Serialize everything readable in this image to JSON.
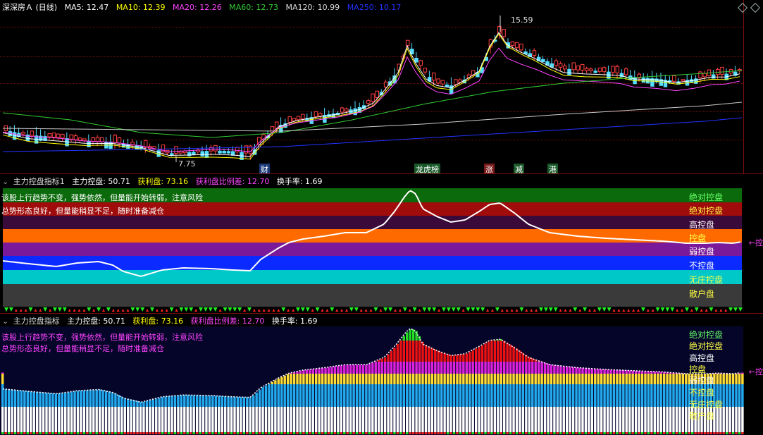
{
  "main": {
    "title": "深深房Ａ (日线)",
    "ma": [
      {
        "label": "MA5: 12.47",
        "color": "#ffffff"
      },
      {
        "label": "MA10: 12.39",
        "color": "#ffff00"
      },
      {
        "label": "MA20: 12.26",
        "color": "#ff44ff"
      },
      {
        "label": "MA60: 12.73",
        "color": "#33cc33"
      },
      {
        "label": "MA120: 10.99",
        "color": "#dddddd"
      },
      {
        "label": "MA250: 10.17",
        "color": "#2233ff"
      }
    ],
    "high_label": "15.59",
    "low_label": "7.75",
    "events": [
      {
        "text": "财",
        "bg": "#1a3a7a",
        "fg": "#ffffff"
      },
      {
        "text": "龙虎榜",
        "bg": "#1a5a2a",
        "fg": "#ffffff"
      },
      {
        "text": "涨",
        "bg": "#7a1a1a",
        "fg": "#ffffff"
      },
      {
        "text": "减",
        "bg": "#1a5a2a",
        "fg": "#ffffff"
      },
      {
        "text": "港",
        "bg": "#1a5a2a",
        "fg": "#ffffff"
      }
    ]
  },
  "panel1": {
    "title": "主力控盘指标1",
    "stats": [
      {
        "text": "主力控盘: 50.71",
        "color": "#ffffff"
      },
      {
        "text": "获利盘: 73.16",
        "color": "#ffff00"
      },
      {
        "text": "获利盘比例差: 12.70",
        "color": "#ff44ff"
      },
      {
        "text": "换手率: 1.69",
        "color": "#ffffff"
      }
    ],
    "note1": "该股上行趋势不变，强势依然，但量能开始转弱，注意风险",
    "note2": "总势形态良好，但量能稍显不足，随时准备减仓",
    "right_label": "←控",
    "bands": [
      {
        "label": "绝对控盘",
        "bg": "#0b6a0b",
        "fg": "#66ff66"
      },
      {
        "label": "绝对控盘",
        "bg": "#a00b0b",
        "fg": "#ffff44"
      },
      {
        "label": "高控盘",
        "bg": "#3a0a3a",
        "fg": "#ffffff"
      },
      {
        "label": "控盘",
        "bg": "#ff6a00",
        "fg": "#ffff44"
      },
      {
        "label": "弱控盘",
        "bg": "#7a1a9a",
        "fg": "#ffffff"
      },
      {
        "label": "不控盘",
        "bg": "#0a2aff",
        "fg": "#ffffff"
      },
      {
        "label": "无庄控盘",
        "bg": "#00c8c8",
        "fg": "#ffff44"
      },
      {
        "label": "散户盘",
        "bg": "#3a3a3a",
        "fg": "#ffff44"
      }
    ]
  },
  "panel2": {
    "title": "主力控盘指标",
    "stats": [
      {
        "text": "主力控盘: 50.71",
        "color": "#ffffff"
      },
      {
        "text": "获利盘: 73.16",
        "color": "#ffff00"
      },
      {
        "text": "获利盘比例差: 12.70",
        "color": "#ff44ff"
      },
      {
        "text": "换手率: 1.69",
        "color": "#ffffff"
      }
    ],
    "note1": "该股上行趋势不变，强势依然，但量能开始转弱，注意风险",
    "note2": "总势形态良好，但量能稍显不足，随时准备减仓",
    "right_label": "←控",
    "labels": [
      {
        "text": "绝对控盘",
        "color": "#66ff66"
      },
      {
        "text": "绝对控盘",
        "color": "#ffff44"
      },
      {
        "text": "高控盘",
        "color": "#ffffff"
      },
      {
        "text": "控盘",
        "color": "#ffff44"
      },
      {
        "text": "弱控盘",
        "color": "#ffffff"
      },
      {
        "text": "不控盘",
        "color": "#ffff44"
      },
      {
        "text": "无庄控盘",
        "color": "#ffff44"
      },
      {
        "text": "散户盘",
        "color": "#ffff44"
      }
    ]
  }
}
